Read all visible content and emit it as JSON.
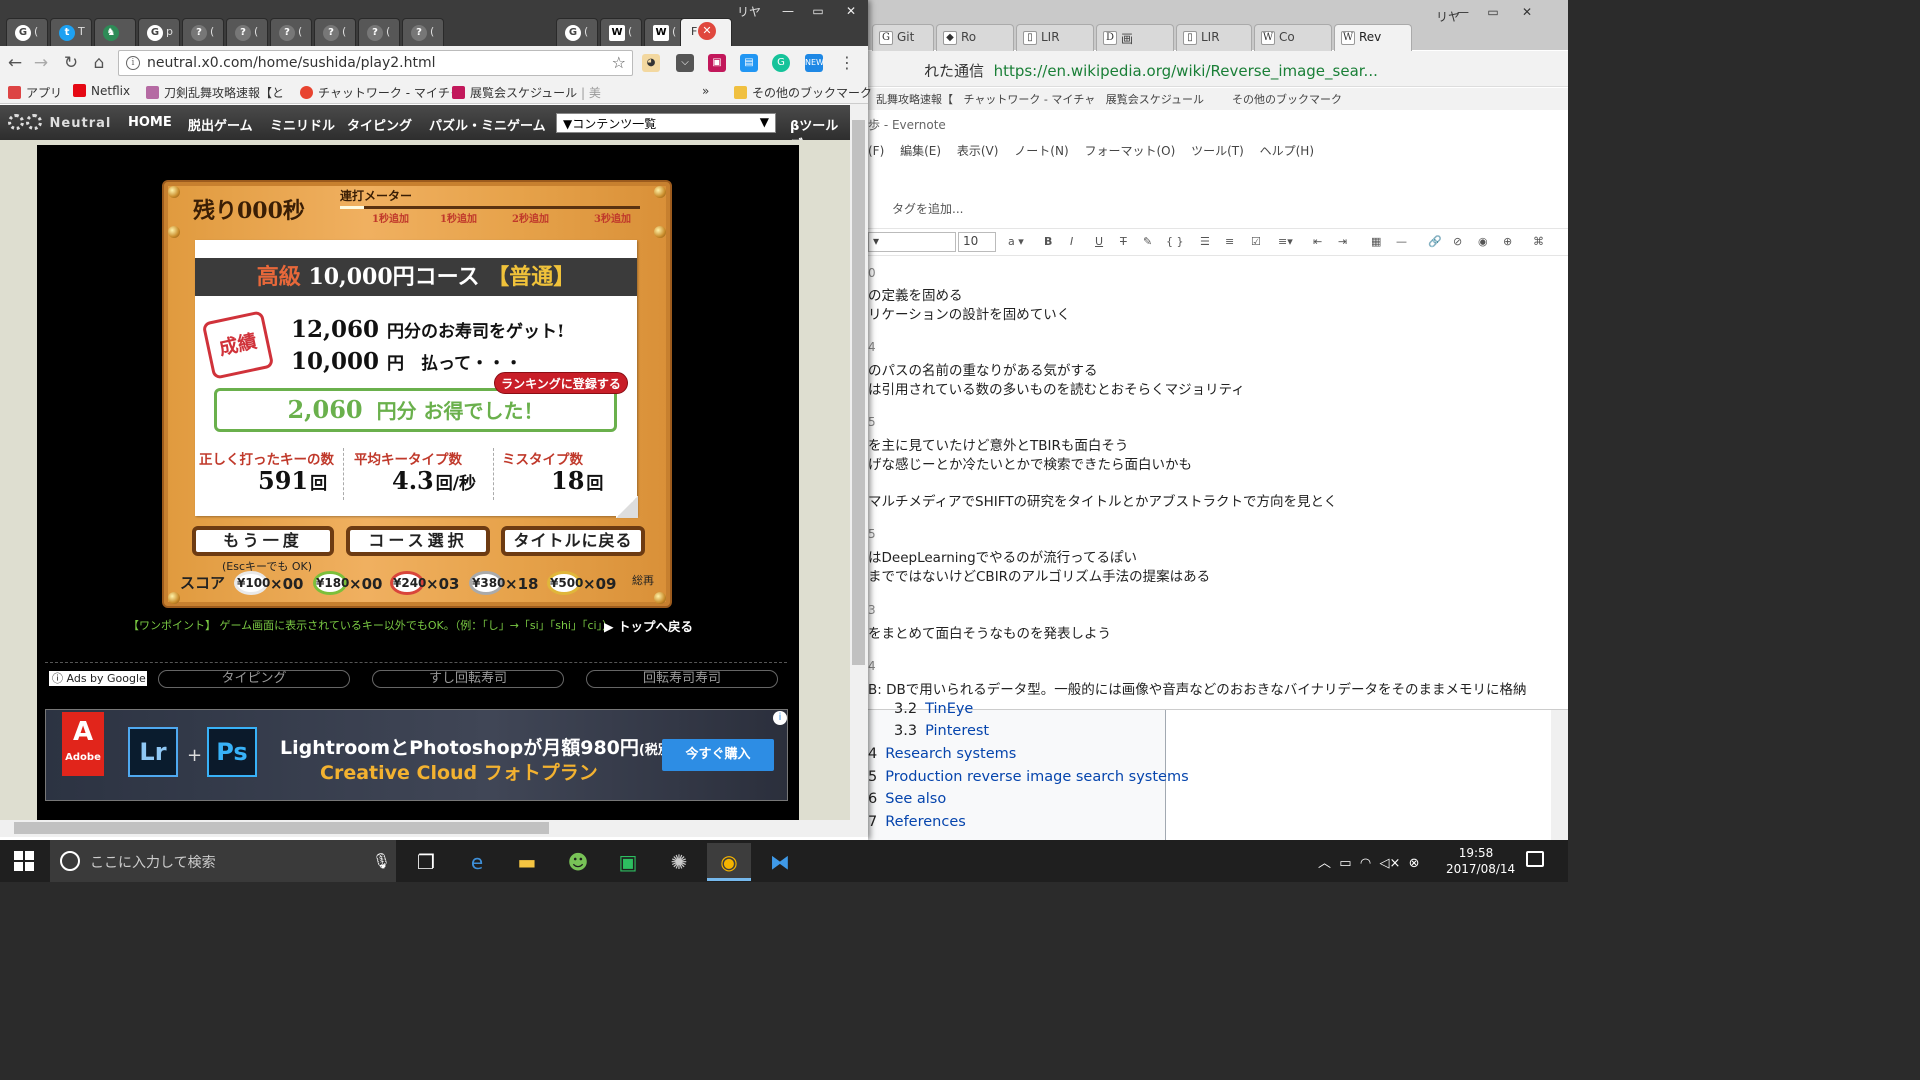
{
  "bg_window": {
    "user": "リヤ",
    "tabs": [
      {
        "icon": "G",
        "label": "Git"
      },
      {
        "icon": "◆",
        "label": "Ro"
      },
      {
        "icon": "▯",
        "label": "LIR"
      },
      {
        "icon": "D",
        "label": "画"
      },
      {
        "icon": "▯",
        "label": "LIR"
      },
      {
        "icon": "W",
        "label": "Co"
      },
      {
        "icon": "W",
        "label": "Rev"
      }
    ],
    "url_prefix": "れた通信",
    "url": "https://en.wikipedia.org/wiki/Reverse_image_sear...",
    "bookmarks_text": "乱舞攻略速報【",
    "bookmarks_items": [
      "チャットワーク - マイチャ",
      "展覧会スケジュール",
      "その他のブックマーク"
    ]
  },
  "evernote": {
    "title": "歩 - Evernote",
    "menu": [
      "(F)",
      "編集(E)",
      "表示(V)",
      "ノート(N)",
      "フォーマット(O)",
      "ツール(T)",
      "ヘルプ(H)"
    ],
    "tag_placeholder": "タグを追加...",
    "font_size": "10",
    "lines": [
      {
        "num": "0",
        "text": ""
      },
      {
        "num": "",
        "text": "の定義を固める"
      },
      {
        "num": "",
        "text": "リケーションの設計を固めていく"
      },
      {
        "num": "4",
        "text": ""
      },
      {
        "num": "",
        "text": "のパスの名前の重なりがある気がする"
      },
      {
        "num": "",
        "text": "は引用されている数の多いものを読むとおそらくマジョリティ"
      },
      {
        "num": "5",
        "text": ""
      },
      {
        "num": "",
        "text": "を主に見ていたけど意外とTBIRも面白そう"
      },
      {
        "num": "",
        "text": "げな感じーとか冷たいとかで検索できたら面白いかも"
      },
      {
        "num": "",
        "text": "マルチメディアでSHIFTの研究をタイトルとかアブストラクトで方向を見とく"
      },
      {
        "num": "5",
        "text": ""
      },
      {
        "num": "",
        "text": "はDeepLearningでやるのが流行ってるぽい"
      },
      {
        "num": "",
        "text": "までではないけどCBIRのアルゴリズム手法の提案はある"
      },
      {
        "num": "3",
        "text": ""
      },
      {
        "num": "",
        "text": "をまとめて面白そうなものを発表しよう"
      },
      {
        "num": "4",
        "text": ""
      },
      {
        "num": "",
        "text": "B: DBで用いられるデータ型。一般的には画像や音声などのおおきなバイナリデータをそのままメモリに格納"
      }
    ]
  },
  "wiki_toc": [
    {
      "n": "3.2",
      "label": "TinEye"
    },
    {
      "n": "3.3",
      "label": "Pinterest"
    },
    {
      "n": "4",
      "label": "Research systems"
    },
    {
      "n": "5",
      "label": "Production reverse image search systems"
    },
    {
      "n": "6",
      "label": "See also"
    },
    {
      "n": "7",
      "label": "References"
    }
  ],
  "fg_window": {
    "user": "リヤ",
    "tabs": [
      {
        "icon": "G",
        "label": "("
      },
      {
        "icon": "t",
        "label": "T"
      },
      {
        "icon": "♞",
        "label": ""
      },
      {
        "icon": "G",
        "label": "p"
      },
      {
        "icon": "?",
        "label": "("
      },
      {
        "icon": "?",
        "label": "("
      },
      {
        "icon": "?",
        "label": "("
      },
      {
        "icon": "?",
        "label": "("
      },
      {
        "icon": "?",
        "label": "("
      },
      {
        "icon": "?",
        "label": "("
      },
      {
        "icon": "G",
        "label": "("
      },
      {
        "icon": "W",
        "label": "("
      },
      {
        "icon": "W",
        "label": "("
      },
      {
        "icon": "",
        "label": "F"
      }
    ],
    "url": "neutral.x0.com/home/sushida/play2.html",
    "bookmarks": [
      {
        "label": "アプリ",
        "color": "#d44"
      },
      {
        "label": "Netflix",
        "color": "#e50914"
      },
      {
        "label": "刀剣乱舞攻略速報【と",
        "color": "#b56aa3"
      },
      {
        "label": "チャットワーク - マイチャ",
        "color": "#e8432f"
      },
      {
        "label": "展覧会スケジュール",
        "color": "#c2185b"
      },
      {
        "label": "その他のブックマーク",
        "color": "#f0c040"
      }
    ]
  },
  "site": {
    "logo": "Neutral",
    "nav": [
      "HOME",
      "脱出ゲーム",
      "ミニリドル",
      "タイピング",
      "パズル・ミニゲーム"
    ],
    "select": "▼コンテンツ一覧",
    "beta": "βツールズ"
  },
  "game": {
    "timer": "残り000秒",
    "meter_label": "連打メーター",
    "meter_fill": 0.08,
    "meter_ticks": [
      "1秒追加",
      "1秒追加",
      "2秒追加",
      "3秒追加"
    ],
    "course_grade": "高級",
    "course_name": "10,000円コース",
    "course_level": "【普通】",
    "stamp": "成績",
    "earned_amount": "12,060",
    "earned_text": "円分のお寿司をゲット!",
    "paid_amount": "10,000",
    "paid_text": "円　払って・・・",
    "rank_button": "ランキングに登録する",
    "profit_amount": "2,060",
    "profit_text": "円分 お得でした！",
    "stats": [
      {
        "label": "正しく打ったキーの数",
        "value": "591",
        "unit": "回"
      },
      {
        "label": "平均キータイプ数",
        "value": "4.3",
        "unit": "回/秒"
      },
      {
        "label": "ミスタイプ数",
        "value": "18",
        "unit": "回"
      }
    ],
    "buttons": [
      "もう一度",
      "コース選択",
      "タイトルに戻る"
    ],
    "esc_hint": "(Escキーでも OK)",
    "score_label": "スコア",
    "plates": [
      {
        "price": "¥100",
        "count": "×00",
        "color": "#e9e9e9"
      },
      {
        "price": "¥180",
        "count": "×00",
        "color": "#7bbf3b"
      },
      {
        "price": "¥240",
        "count": "×03",
        "color": "#d9453b"
      },
      {
        "price": "¥380",
        "count": "×18",
        "color": "#aaaaaa"
      },
      {
        "price": "¥500",
        "count": "×09",
        "color": "#e0b63a"
      }
    ],
    "furikake": "総再",
    "onepoint": "【ワンポイント】 ゲーム画面に表示されているキー以外でもOK。（例：「し」→「si」「shi」「ci」）",
    "back_top": "▶ トップへ戻る"
  },
  "ads": {
    "ads_by": "Ads by Google",
    "links": [
      "タイピング",
      "すし回転寿司",
      "回転寿司寿司"
    ],
    "banner_brand": "Adobe",
    "banner_app1": "Lr",
    "banner_app2": "Ps",
    "banner_line1": "LightroomとPhotoshopが月額980円",
    "banner_line1_small": "(税別)",
    "banner_line2": "Creative Cloud フォトプラン",
    "banner_cta": "今すぐ購入"
  },
  "taskbar": {
    "search_placeholder": "ここに入力して検索",
    "time": "19:58",
    "date": "2017/08/14",
    "apps": [
      "task-view",
      "edge",
      "explorer",
      "android",
      "evernote",
      "network",
      "chrome",
      "vscode"
    ]
  }
}
